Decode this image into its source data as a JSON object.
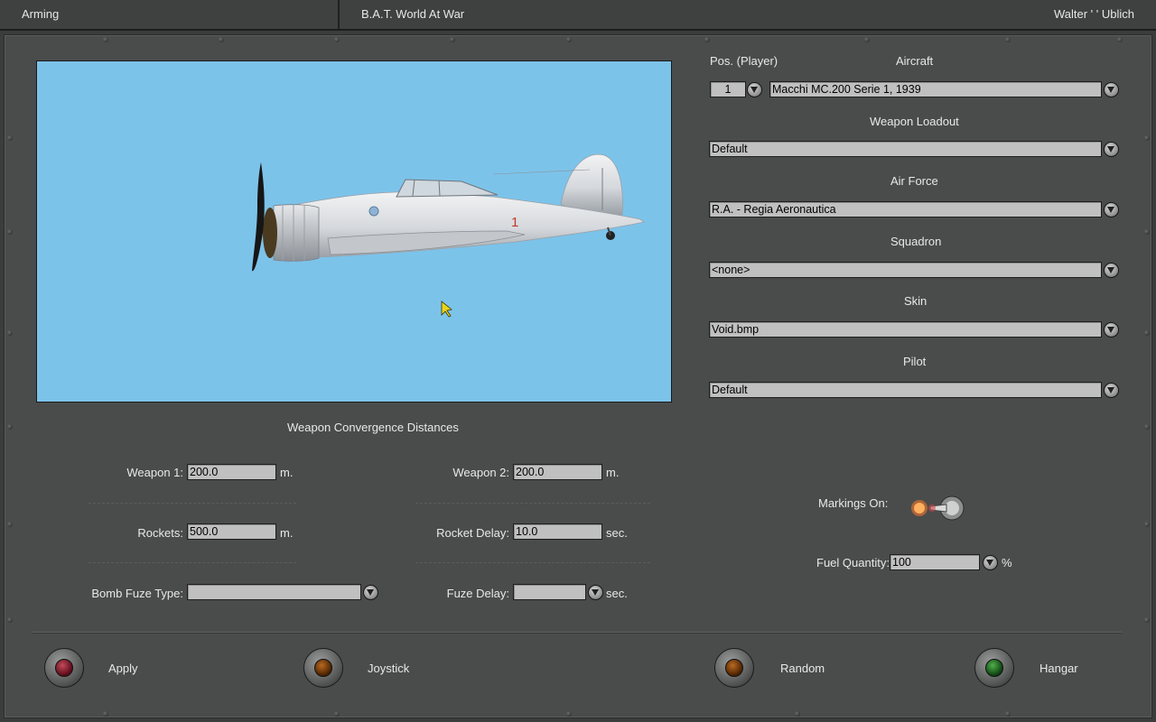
{
  "window": {
    "section": "Arming",
    "title": "B.A.T. World At War",
    "user": "Walter ' ' Ublich"
  },
  "preview": {
    "aircraft_marking": "1",
    "sky_color": "#7cc3ea"
  },
  "right": {
    "pos_label": "Pos. (Player)",
    "pos_value": "1",
    "aircraft_label": "Aircraft",
    "aircraft_value": "Macchi MC.200 Serie 1, 1939",
    "loadout_label": "Weapon Loadout",
    "loadout_value": "Default",
    "airforce_label": "Air Force",
    "airforce_value": "R.A. - Regia Aeronautica",
    "squadron_label": "Squadron",
    "squadron_value": "<none>",
    "skin_label": "Skin",
    "skin_value": "Void.bmp",
    "pilot_label": "Pilot",
    "pilot_value": "Default",
    "markings_label": "Markings On:",
    "markings_on": true,
    "fuel_label": "Fuel Quantity:",
    "fuel_value": "100",
    "fuel_unit": "%"
  },
  "convergence": {
    "heading": "Weapon Convergence Distances",
    "weapon1_label": "Weapon 1:",
    "weapon1_value": "200.0",
    "weapon1_unit": "m.",
    "weapon2_label": "Weapon 2:",
    "weapon2_value": "200.0",
    "weapon2_unit": "m.",
    "rockets_label": "Rockets:",
    "rockets_value": "500.0",
    "rockets_unit": "m.",
    "rocket_delay_label": "Rocket Delay:",
    "rocket_delay_value": "10.0",
    "rocket_delay_unit": "sec.",
    "bomb_fuze_label": "Bomb Fuze Type:",
    "bomb_fuze_value": "",
    "fuze_delay_label": "Fuze Delay:",
    "fuze_delay_value": "",
    "fuze_delay_unit": "sec."
  },
  "buttons": {
    "apply": "Apply",
    "joystick": "Joystick",
    "random": "Random",
    "hangar": "Hangar"
  },
  "colors": {
    "panel": "#4a4c4b",
    "field": "#bfc0bf",
    "lamp_apply": "red",
    "lamp_joystick": "amber",
    "lamp_random": "amber",
    "lamp_hangar": "green"
  }
}
